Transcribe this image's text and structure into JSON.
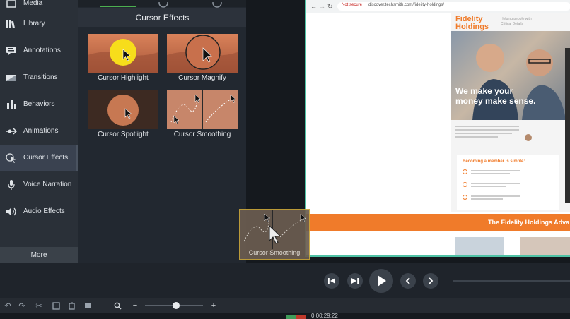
{
  "sidebar": {
    "items": [
      {
        "label": "Media",
        "icon": "media-icon"
      },
      {
        "label": "Library",
        "icon": "library-icon"
      },
      {
        "label": "Annotations",
        "icon": "annotations-icon"
      },
      {
        "label": "Transitions",
        "icon": "transitions-icon"
      },
      {
        "label": "Behaviors",
        "icon": "behaviors-icon"
      },
      {
        "label": "Animations",
        "icon": "animations-icon"
      },
      {
        "label": "Cursor Effects",
        "icon": "cursor-effects-icon"
      },
      {
        "label": "Voice Narration",
        "icon": "microphone-icon"
      },
      {
        "label": "Audio Effects",
        "icon": "speaker-icon"
      }
    ],
    "more_label": "More"
  },
  "panel": {
    "title": "Cursor Effects",
    "effects": [
      {
        "label": "Cursor Highlight"
      },
      {
        "label": "Cursor Magnify"
      },
      {
        "label": "Cursor Spotlight"
      },
      {
        "label": "Cursor Smoothing"
      }
    ],
    "drag_label": "Cursor Smoothing"
  },
  "browser": {
    "security_label": "Not secure",
    "url": "discover.techsmith.com/fidelity-holdings/",
    "brand_line1": "Fidelity",
    "brand_line2": "Holdings",
    "tagline_line1": "Helping people with",
    "tagline_line2": "Critical Details",
    "hero_line1": "We make your",
    "hero_line2": "money make sense.",
    "steps_title": "Becoming a member is simple:",
    "banner": "The Fidelity Holdings Adva"
  },
  "timeline": {
    "timecode": "0:00:29;22"
  },
  "colors": {
    "accent_green": "#4fc2a5",
    "brand_orange": "#f07b2a",
    "active_tab_green": "#4caf50"
  }
}
